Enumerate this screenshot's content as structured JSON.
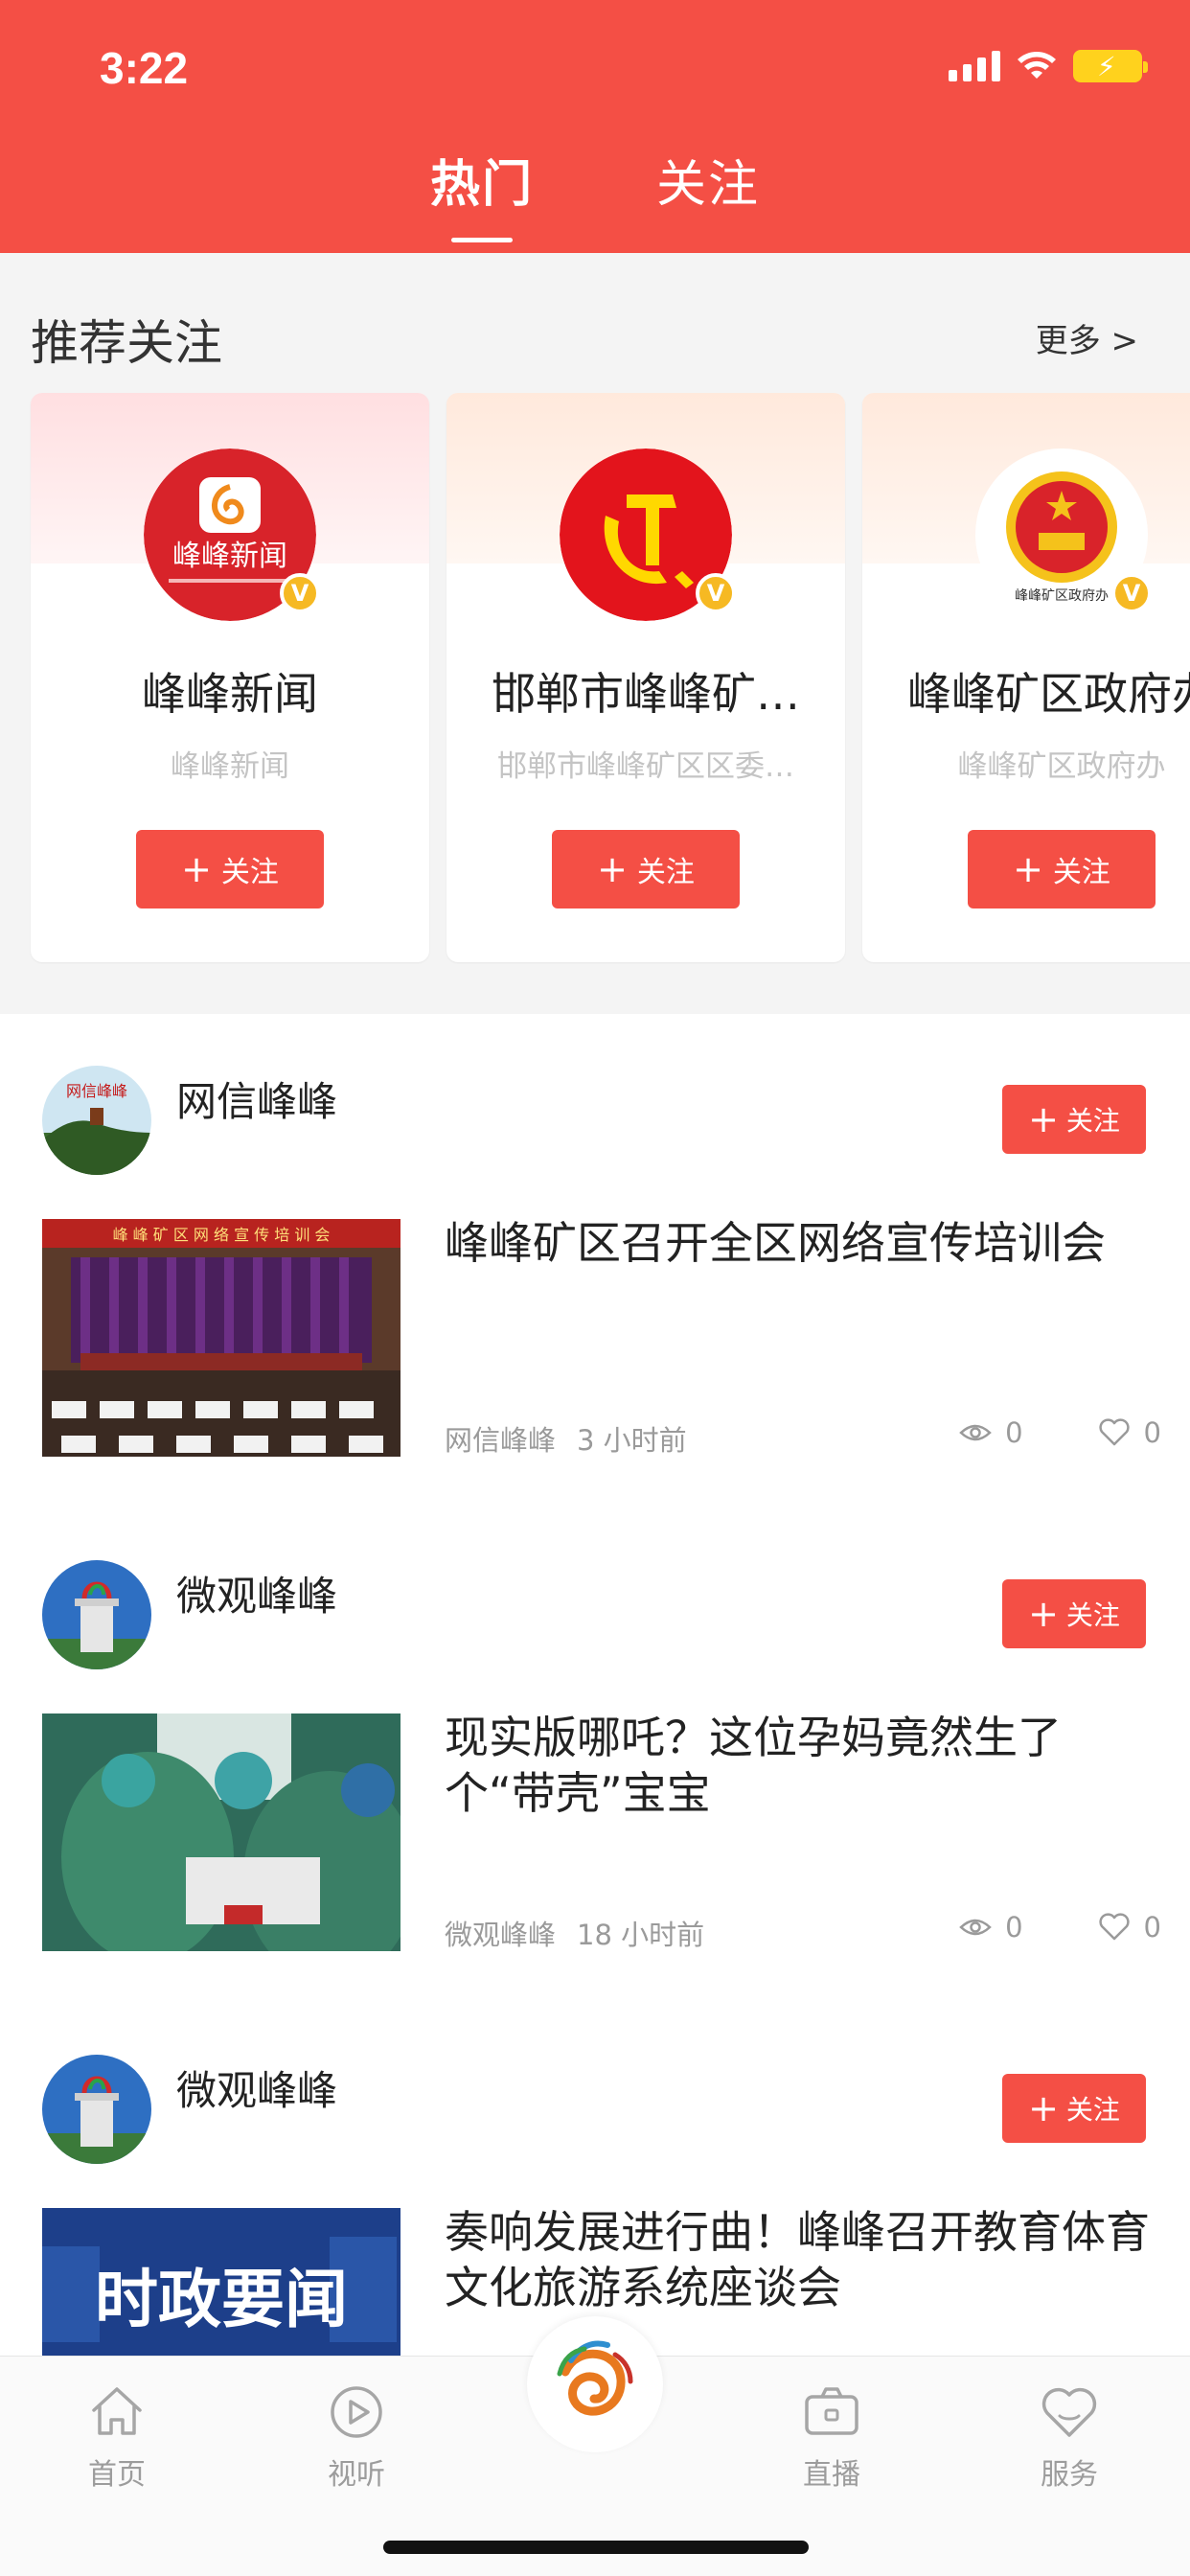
{
  "status_bar": {
    "time": "3:22"
  },
  "top_tabs": [
    {
      "label": "热门",
      "active": true
    },
    {
      "label": "关注",
      "active": false
    }
  ],
  "recommended": {
    "title": "推荐关注",
    "more": "更多 >",
    "cards": [
      {
        "name": "峰峰新闻",
        "subtitle": "峰峰新闻",
        "follow_label": "关注",
        "avatar_text": "峰峰新闻"
      },
      {
        "name": "邯郸市峰峰矿…",
        "subtitle": "邯郸市峰峰矿区区委…",
        "follow_label": "关注"
      },
      {
        "name": "峰峰矿区政府办",
        "subtitle": "峰峰矿区政府办",
        "follow_label": "关注",
        "avatar_text": "峰峰矿区政府办"
      }
    ]
  },
  "feed": [
    {
      "author": "网信峰峰",
      "author_avatar_text": "网信峰峰",
      "follow_label": "关注",
      "title": "峰峰矿区召开全区网络宣传培训会",
      "thumb_banner": "峰 峰 矿 区 网 络 宣 传 培 训 会",
      "meta_author": "网信峰峰",
      "time": "3 小时前",
      "views": "0",
      "likes": "0"
    },
    {
      "author": "微观峰峰",
      "follow_label": "关注",
      "title": "现实版哪吒？这位孕妈竟然生了个“带壳”宝宝",
      "meta_author": "微观峰峰",
      "time": "18 小时前",
      "views": "0",
      "likes": "0"
    },
    {
      "author": "微观峰峰",
      "follow_label": "关注",
      "title": "奏响发展进行曲！峰峰召开教育体育文化旅游系统座谈会",
      "thumb_text": "时政要闻"
    }
  ],
  "tab_bar": [
    {
      "label": "首页",
      "icon": "home-icon"
    },
    {
      "label": "视听",
      "icon": "play-icon"
    },
    {
      "label": "",
      "icon": "center-logo"
    },
    {
      "label": "直播",
      "icon": "live-camera-icon"
    },
    {
      "label": "服务",
      "icon": "heart-service-icon"
    }
  ],
  "colors": {
    "brand": "#f44f45",
    "badge": "#f6b923",
    "muted": "#9a9a9a"
  }
}
